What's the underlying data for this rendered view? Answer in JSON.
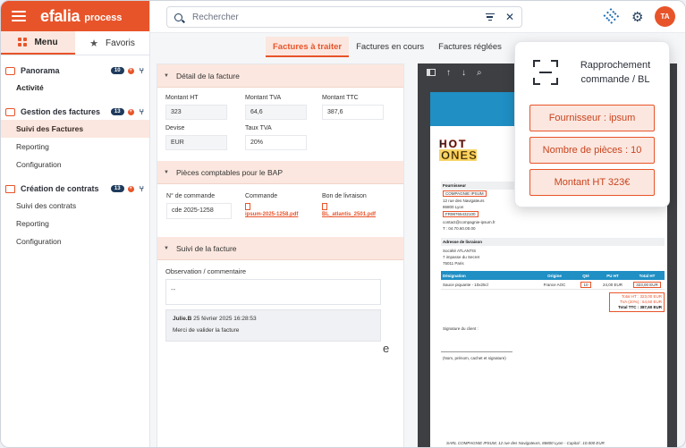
{
  "brand": {
    "name": "efalia",
    "product": "process"
  },
  "menu_tabs": [
    {
      "label": "Menu"
    },
    {
      "label": "Favoris"
    }
  ],
  "sidebar": {
    "sections": [
      {
        "title": "Panorama",
        "count": "10",
        "items": [
          {
            "label": "Activité"
          }
        ]
      },
      {
        "title": "Gestion des factures",
        "count": "13",
        "items": [
          {
            "label": "Suivi des Factures"
          },
          {
            "label": "Reporting"
          },
          {
            "label": "Configuration"
          }
        ]
      },
      {
        "title": "Création de contrats",
        "count": "13",
        "items": [
          {
            "label": "Suivi des contrats"
          },
          {
            "label": "Reporting"
          },
          {
            "label": "Configuration"
          }
        ]
      }
    ]
  },
  "search": {
    "placeholder": "Rechercher"
  },
  "user": {
    "initials": "TA"
  },
  "tabs": [
    {
      "label": "Factures à traiter"
    },
    {
      "label": "Factures en cours"
    },
    {
      "label": "Factures réglées"
    }
  ],
  "detail": {
    "title": "Détail de la facture",
    "fields": [
      {
        "label": "Montant HT",
        "value": "323"
      },
      {
        "label": "Montant TVA",
        "value": "64,6"
      },
      {
        "label": "Montant TTC",
        "value": "387,6"
      },
      {
        "label": "Devise",
        "value": "EUR"
      },
      {
        "label": "Taux TVA",
        "value": "20%"
      }
    ]
  },
  "bap": {
    "title": "Pièces comptables pour le BAP",
    "order_label": "N° de commande",
    "order_value": "cde 2025-1258",
    "commande_label": "Commande",
    "commande_file": "ipsum-2025-1258.pdf",
    "bl_label": "Bon de livraison",
    "bl_file": "BL_atlantis_2501.pdf"
  },
  "suivi": {
    "title": "Suivi de la facture",
    "obs_label": "Observation / commentaire",
    "obs_value": "--",
    "comment_author": "Julie.B",
    "comment_date": "25 février 2025 16:28:53",
    "comment_text": "Merci de valider la facture",
    "trailing": "e"
  },
  "invoice": {
    "logo_top": "HOT",
    "logo_bottom": "ONES",
    "supplier_title": "Fournisseur",
    "supplier_name": "COMPAGNIE IPSUM",
    "supplier_addr1": "12 rue des Navigateurs",
    "supplier_addr2": "86800 Lyon",
    "supplier_siret": "FR98765432100",
    "supplier_email": "contact@compagnie-ipsum.fr",
    "supplier_tel": "T : 04.70.60.00.00",
    "delivery_title": "Adresse de livraison",
    "delivery_name": "Société ATLANTIS",
    "delivery_addr1": "7 impasse du Secret",
    "delivery_addr2": "75011 Paris",
    "columns": [
      "Désignation",
      "Origine",
      "Qté",
      "PU HT",
      "Total HT"
    ],
    "row": [
      "Sauce piquante - 10x25cl",
      "France AOC",
      "10",
      "24,00 EUR",
      "323,00 EUR"
    ],
    "total_ht": "Total HT : 323,00 EUR",
    "tva": "TVA (20%) : 64,60 EUR",
    "total_ttc": "Total TTC : 387,60 EUR",
    "signature_label": "Signature du client :",
    "signature_note": "(Nom, prénom, cachet et signature)",
    "footer": "SARL COMPAGNIE IPSUM, 12 rue des Navigateurs, 86800 Lyon - Capital : 10.000 EUR"
  },
  "popup": {
    "title": "Rapprochement commande / BL",
    "chips": [
      "Fournisseur : ipsum",
      "Nombre de pièces : 10",
      "Montant HT 323€"
    ]
  },
  "colors": {
    "accent": "#e8542a",
    "navy": "#1f3b5c",
    "invoice_blue": "#1f8fc4"
  }
}
